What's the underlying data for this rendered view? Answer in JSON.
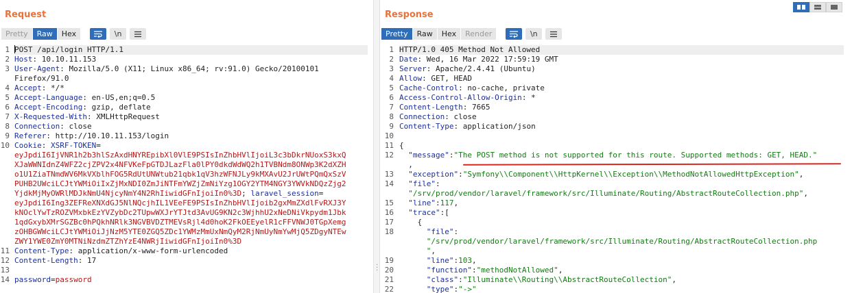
{
  "request": {
    "title": "Request",
    "tabs": [
      "Pretty",
      "Raw",
      "Hex"
    ],
    "active_tab": "Raw",
    "wrap_icon": "word-wrap-icon",
    "newline_label": "\\n",
    "menu_icon": "menu-icon",
    "lines": [
      {
        "n": "1",
        "parts": [
          {
            "t": "POST /api/login HTTP/1.1",
            "c": ""
          }
        ]
      },
      {
        "n": "2",
        "parts": [
          {
            "t": "Host",
            "c": "key"
          },
          {
            "t": ": 10.10.11.153",
            "c": ""
          }
        ]
      },
      {
        "n": "3",
        "parts": [
          {
            "t": "User-Agent",
            "c": "key"
          },
          {
            "t": ": Mozilla/5.0 (X11; Linux x86_64; rv:91.0) Gecko/20100101",
            "c": ""
          }
        ]
      },
      {
        "n": "",
        "parts": [
          {
            "t": "Firefox/91.0",
            "c": ""
          }
        ]
      },
      {
        "n": "4",
        "parts": [
          {
            "t": "Accept",
            "c": "key"
          },
          {
            "t": ": */*",
            "c": ""
          }
        ]
      },
      {
        "n": "5",
        "parts": [
          {
            "t": "Accept-Language",
            "c": "key"
          },
          {
            "t": ": en-US,en;q=0.5",
            "c": ""
          }
        ]
      },
      {
        "n": "6",
        "parts": [
          {
            "t": "Accept-Encoding",
            "c": "key"
          },
          {
            "t": ": gzip, deflate",
            "c": ""
          }
        ]
      },
      {
        "n": "7",
        "parts": [
          {
            "t": "X-Requested-With",
            "c": "key"
          },
          {
            "t": ": XMLHttpRequest",
            "c": ""
          }
        ]
      },
      {
        "n": "8",
        "parts": [
          {
            "t": "Connection",
            "c": "key"
          },
          {
            "t": ": close",
            "c": ""
          }
        ]
      },
      {
        "n": "9",
        "parts": [
          {
            "t": "Referer",
            "c": "key"
          },
          {
            "t": ": http://10.10.11.153/login",
            "c": ""
          }
        ]
      },
      {
        "n": "10",
        "parts": [
          {
            "t": "Cookie",
            "c": "key"
          },
          {
            "t": ": ",
            "c": ""
          },
          {
            "t": "XSRF-TOKEN",
            "c": "key"
          },
          {
            "t": "=",
            "c": ""
          }
        ]
      },
      {
        "n": "",
        "parts": [
          {
            "t": "eyJpdiI6IjVNR1h2b3hlSzAxdHNYREpibXl0VlE9PSIsInZhbHVlIjoiL3c3bDkrNUoxS3kxQ",
            "c": "val"
          }
        ]
      },
      {
        "n": "",
        "parts": [
          {
            "t": "XJaWWNIdnZ4WFZ2cjZPV2x4NFVKeFpGTDJLazFla0lPY0dkdWdWQ2h1TVBNdm8ONWp3K2dXZH",
            "c": "val"
          }
        ]
      },
      {
        "n": "",
        "parts": [
          {
            "t": "o1U1ZiaTNmdWV6MkVXblhFOG5RdUtUNWtub21qbk1qV3hzWFNJLy9kMXAvU2JrUWtPQmQxSzV",
            "c": "val"
          }
        ]
      },
      {
        "n": "",
        "parts": [
          {
            "t": "PUHB2UWciLCJtYWMiOiIxZjMxNDI0ZmJiNTFmYWZjZmNiYzg1OGY2YTM4NGY3YWVkNDQzZjg2",
            "c": "val"
          }
        ]
      },
      {
        "n": "",
        "parts": [
          {
            "t": "YjdkMjMyOWRlMDJkNmU4NjcyNmY4N2RhIiwidGFnIjoiIn0%3D",
            "c": "val"
          },
          {
            "t": "; ",
            "c": ""
          },
          {
            "t": "laravel_session",
            "c": "key"
          },
          {
            "t": "=",
            "c": ""
          }
        ]
      },
      {
        "n": "",
        "parts": [
          {
            "t": "eyJpdiI6Ing3ZEFReXNXdGJ5NlNQcjhIL1VEeFE9PSIsInZhbHVlIjoib2gxMmZXdlFvRXJ3Y",
            "c": "val"
          }
        ]
      },
      {
        "n": "",
        "parts": [
          {
            "t": "kNOclYwTzROZVMxbkEzYVZybDc2TUpwWXJrYTJtd3AvUG9KN2c3WjhhU2xNeDNiVkpydm1Jbk",
            "c": "val"
          }
        ]
      },
      {
        "n": "",
        "parts": [
          {
            "t": "1qdGxybXMrSGZBc0hPQkhNRlk3NGVBVDZTMEVsRjl4d0hoK2FkOEEyelR1cFFVNWJ0TGpXemg",
            "c": "val"
          }
        ]
      },
      {
        "n": "",
        "parts": [
          {
            "t": "zOHBGWWciLCJtYWMiOiJjNzM5YTE0ZGQ5ZDc1YWMzMmUxNmQyM2RjNmUyNmYwMjQ5ZDgyNTEw",
            "c": "val"
          }
        ]
      },
      {
        "n": "",
        "parts": [
          {
            "t": "ZWY1YWE0ZmY0MTNiNzdmZTZhYzE4NWRjIiwidGFnIjoiIn0%3D",
            "c": "val"
          }
        ]
      },
      {
        "n": "11",
        "parts": [
          {
            "t": "Content-Type",
            "c": "key"
          },
          {
            "t": ": application/x-www-form-urlencoded",
            "c": ""
          }
        ]
      },
      {
        "n": "12",
        "parts": [
          {
            "t": "Content-Length",
            "c": "key"
          },
          {
            "t": ": 17",
            "c": ""
          }
        ]
      },
      {
        "n": "13",
        "parts": []
      },
      {
        "n": "14",
        "parts": [
          {
            "t": "password",
            "c": "key"
          },
          {
            "t": "=",
            "c": ""
          },
          {
            "t": "password",
            "c": "val"
          }
        ]
      }
    ]
  },
  "response": {
    "title": "Response",
    "tabs": [
      "Pretty",
      "Raw",
      "Hex",
      "Render"
    ],
    "active_tab": "Pretty",
    "disabled_tab": "Render",
    "newline_label": "\\n",
    "view_modes": [
      "side-by-side-view-icon",
      "horizontal-split-view-icon",
      "single-pane-view-icon"
    ],
    "lines": [
      {
        "n": "1",
        "parts": [
          {
            "t": "HTTP/1.0 405 Method Not Allowed",
            "c": ""
          }
        ]
      },
      {
        "n": "2",
        "parts": [
          {
            "t": "Date",
            "c": "key"
          },
          {
            "t": ": Wed, 16 Mar 2022 17:59:19 GMT",
            "c": ""
          }
        ]
      },
      {
        "n": "3",
        "parts": [
          {
            "t": "Server",
            "c": "key"
          },
          {
            "t": ": Apache/2.4.41 (Ubuntu)",
            "c": ""
          }
        ]
      },
      {
        "n": "4",
        "parts": [
          {
            "t": "Allow",
            "c": "key"
          },
          {
            "t": ": GET, HEAD",
            "c": ""
          }
        ]
      },
      {
        "n": "5",
        "parts": [
          {
            "t": "Cache-Control",
            "c": "key"
          },
          {
            "t": ": no-cache, private",
            "c": ""
          }
        ]
      },
      {
        "n": "6",
        "parts": [
          {
            "t": "Access-Control-Allow-Origin",
            "c": "key"
          },
          {
            "t": ": *",
            "c": ""
          }
        ]
      },
      {
        "n": "7",
        "parts": [
          {
            "t": "Content-Length",
            "c": "key"
          },
          {
            "t": ": 7665",
            "c": ""
          }
        ]
      },
      {
        "n": "8",
        "parts": [
          {
            "t": "Connection",
            "c": "key"
          },
          {
            "t": ": close",
            "c": ""
          }
        ]
      },
      {
        "n": "9",
        "parts": [
          {
            "t": "Content-Type",
            "c": "key"
          },
          {
            "t": ": application/json",
            "c": ""
          }
        ]
      },
      {
        "n": "10",
        "parts": []
      },
      {
        "n": "11",
        "parts": [
          {
            "t": "{",
            "c": ""
          }
        ]
      },
      {
        "n": "12",
        "parts": [
          {
            "t": "  \"message\"",
            "c": "key"
          },
          {
            "t": ":",
            "c": ""
          },
          {
            "t": "\"The POST method is not supported for this route. Supported methods: GET, HEAD.\"",
            "c": "str"
          }
        ]
      },
      {
        "n": "",
        "parts": [
          {
            "t": "  ,",
            "c": ""
          }
        ]
      },
      {
        "n": "13",
        "parts": [
          {
            "t": "  \"exception\"",
            "c": "key"
          },
          {
            "t": ":",
            "c": ""
          },
          {
            "t": "\"Symfony\\\\Component\\\\HttpKernel\\\\Exception\\\\MethodNotAllowedHttpException\"",
            "c": "str"
          },
          {
            "t": ",",
            "c": ""
          }
        ]
      },
      {
        "n": "14",
        "parts": [
          {
            "t": "  \"file\"",
            "c": "key"
          },
          {
            "t": ":",
            "c": ""
          }
        ]
      },
      {
        "n": "",
        "parts": [
          {
            "t": "  \"/srv/prod/vendor/laravel/framework/src/Illuminate/Routing/AbstractRouteCollection.php\"",
            "c": "str"
          },
          {
            "t": ",",
            "c": ""
          }
        ]
      },
      {
        "n": "15",
        "parts": [
          {
            "t": "  \"line\"",
            "c": "key"
          },
          {
            "t": ":",
            "c": ""
          },
          {
            "t": "117",
            "c": "num"
          },
          {
            "t": ",",
            "c": ""
          }
        ]
      },
      {
        "n": "16",
        "parts": [
          {
            "t": "  \"trace\"",
            "c": "key"
          },
          {
            "t": ":[",
            "c": ""
          }
        ]
      },
      {
        "n": "17",
        "parts": [
          {
            "t": "    {",
            "c": ""
          }
        ]
      },
      {
        "n": "18",
        "parts": [
          {
            "t": "      \"file\"",
            "c": "key"
          },
          {
            "t": ":",
            "c": ""
          }
        ]
      },
      {
        "n": "",
        "parts": [
          {
            "t": "      \"/srv/prod/vendor/laravel/framework/src/Illuminate/Routing/AbstractRouteCollection.php",
            "c": "str"
          }
        ]
      },
      {
        "n": "",
        "parts": [
          {
            "t": "      \"",
            "c": "str"
          },
          {
            "t": ",",
            "c": ""
          }
        ]
      },
      {
        "n": "19",
        "parts": [
          {
            "t": "      \"line\"",
            "c": "key"
          },
          {
            "t": ":",
            "c": ""
          },
          {
            "t": "103",
            "c": "num"
          },
          {
            "t": ",",
            "c": ""
          }
        ]
      },
      {
        "n": "20",
        "parts": [
          {
            "t": "      \"function\"",
            "c": "key"
          },
          {
            "t": ":",
            "c": ""
          },
          {
            "t": "\"methodNotAllowed\"",
            "c": "str"
          },
          {
            "t": ",",
            "c": ""
          }
        ]
      },
      {
        "n": "21",
        "parts": [
          {
            "t": "      \"class\"",
            "c": "key"
          },
          {
            "t": ":",
            "c": ""
          },
          {
            "t": "\"Illuminate\\\\Routing\\\\AbstractRouteCollection\"",
            "c": "str"
          },
          {
            "t": ",",
            "c": ""
          }
        ]
      },
      {
        "n": "22",
        "parts": [
          {
            "t": "      \"type\"",
            "c": "key"
          },
          {
            "t": ":",
            "c": ""
          },
          {
            "t": "\"->\"",
            "c": "str"
          }
        ]
      }
    ]
  },
  "colors": {
    "accent": "#e8733a",
    "active_tab": "#2f6db8",
    "annotation": "#d9251c"
  }
}
